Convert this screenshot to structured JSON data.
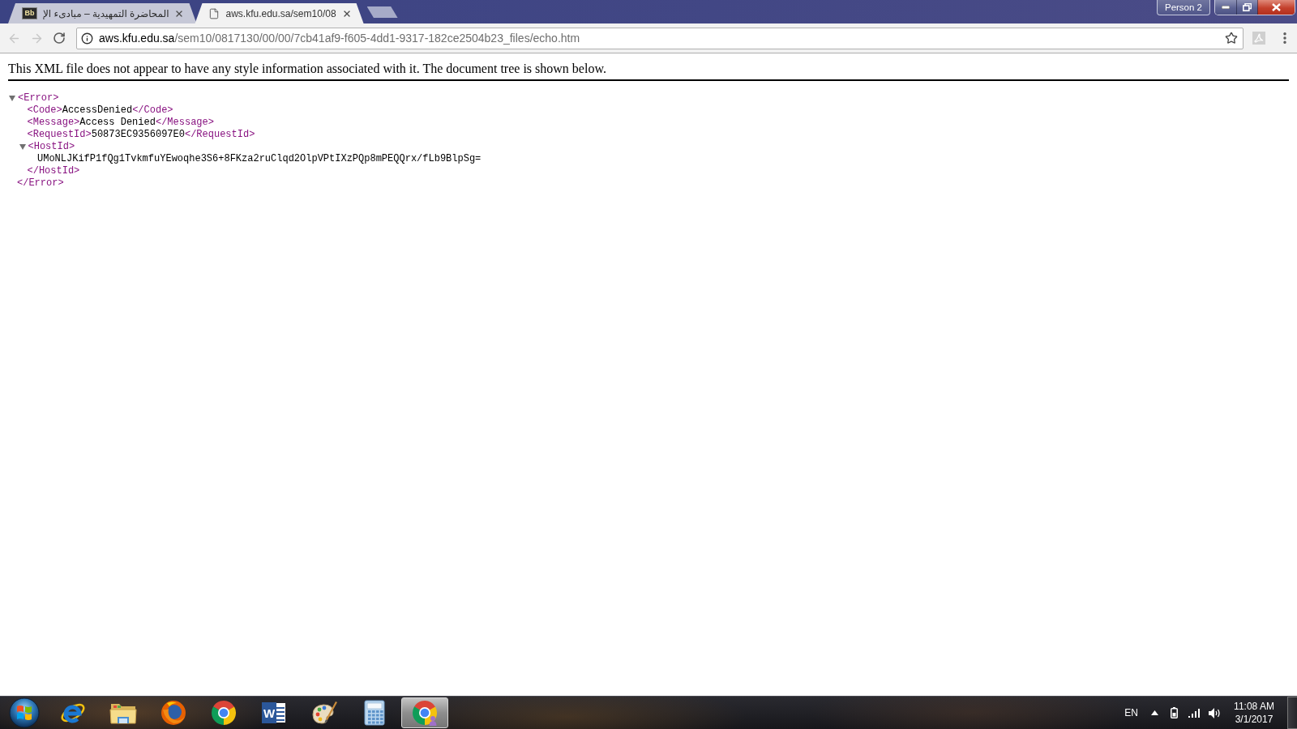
{
  "tabs": [
    {
      "title": "المحاضرة التمهيدية – مبادىء الإ",
      "selected": false,
      "favicon": {
        "kind": "logo",
        "text": "Bb"
      }
    },
    {
      "title": "aws.kfu.edu.sa/sem10/08",
      "selected": true,
      "favicon": {
        "kind": "page"
      }
    }
  ],
  "window": {
    "profile_button": "Person 2"
  },
  "toolbar": {
    "back": {
      "disabled": true
    },
    "forward": {
      "disabled": true
    },
    "url": {
      "host": "aws.kfu.edu.sa",
      "path": "/sem10/0817130/00/00/7cb41af9-f605-4dd1-9317-182ce2504b23_files/echo.htm"
    }
  },
  "page": {
    "notice": "This XML file does not appear to have any style information associated with it. The document tree is shown below.",
    "tree": {
      "kind": "branch",
      "open": "<Error>",
      "close": "</Error>",
      "expanded": true,
      "children": [
        {
          "kind": "leaf",
          "open": "<Code>",
          "text": "AccessDenied",
          "close": "</Code>"
        },
        {
          "kind": "leaf",
          "open": "<Message>",
          "text": "Access Denied",
          "close": "</Message>"
        },
        {
          "kind": "leaf",
          "open": "<RequestId>",
          "text": "50873EC9356097E0",
          "close": "</RequestId>"
        },
        {
          "kind": "branch",
          "open": "<HostId>",
          "close": "</HostId>",
          "expanded": true,
          "children": [
            {
              "kind": "text",
              "text": "UMoNLJKifP1fQg1TvkmfuYEwoqhe3S6+8FKza2ruClqd2OlpVPtIXzPQp8mPEQQrx/fLb9BlpSg="
            }
          ]
        }
      ]
    }
  },
  "taskbar": {
    "apps": [
      {
        "kind": "internet",
        "selected": false
      },
      {
        "kind": "files",
        "selected": false
      },
      {
        "kind": "firefox",
        "selected": false
      },
      {
        "kind": "chrome",
        "selected": false
      },
      {
        "kind": "word",
        "selected": false,
        "logo_text": "W"
      },
      {
        "kind": "paint",
        "selected": false
      },
      {
        "kind": "calculator",
        "selected": false
      },
      {
        "kind": "chromeprofile",
        "selected": true
      }
    ],
    "tray": {
      "language": "EN",
      "time": "11:08 AM",
      "date": "3/1/2017"
    }
  }
}
